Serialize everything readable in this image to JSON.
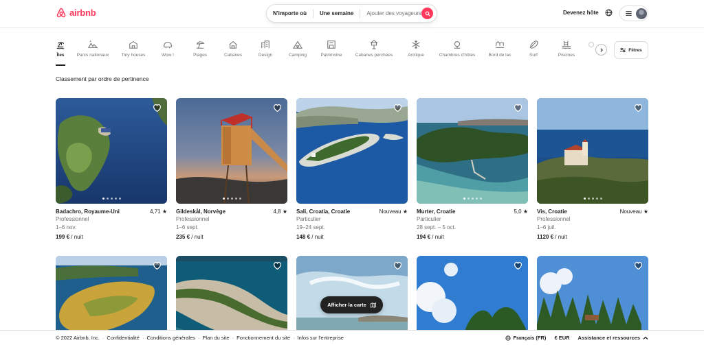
{
  "brand": {
    "name": "airbnb",
    "color": "#ff385c"
  },
  "search": {
    "where": "N'importe où",
    "when": "Une semaine",
    "who": "Ajouter des voyageurs",
    "button_icon": "search-icon"
  },
  "header": {
    "host_label": "Devenez hôte",
    "language_icon": "globe-icon",
    "menu_icon": "hamburger-icon"
  },
  "categories": [
    {
      "label": "Îles",
      "icon": "island-icon",
      "active": true
    },
    {
      "label": "Parcs nationaux",
      "icon": "national-park-icon"
    },
    {
      "label": "Tiny houses",
      "icon": "tiny-house-icon"
    },
    {
      "label": "Wow !",
      "icon": "wow-icon"
    },
    {
      "label": "Plages",
      "icon": "beach-icon"
    },
    {
      "label": "Cabanes",
      "icon": "cabin-icon"
    },
    {
      "label": "Design",
      "icon": "design-icon"
    },
    {
      "label": "Camping",
      "icon": "camping-icon"
    },
    {
      "label": "Patrimoine",
      "icon": "heritage-icon"
    },
    {
      "label": "Cabanes perchées",
      "icon": "treehouse-icon"
    },
    {
      "label": "Arctique",
      "icon": "snowflake-icon"
    },
    {
      "label": "Chambres d'hôtes",
      "icon": "bed-breakfast-icon"
    },
    {
      "label": "Bord de lac",
      "icon": "lake-icon"
    },
    {
      "label": "Surf",
      "icon": "surf-icon"
    },
    {
      "label": "Piscines",
      "icon": "pool-icon"
    }
  ],
  "filters_label": "Filtres",
  "sort_label": "Classement par ordre de pertinence",
  "listings": [
    {
      "title": "Badachro, Royaume-Uni",
      "rating": "4,71 ★",
      "host": "Professionnel",
      "dates": "1–6 nov.",
      "price": "199 €",
      "per": " / nuit"
    },
    {
      "title": "Gildeskål, Norvège",
      "rating": "4,8 ★",
      "host": "Professionnel",
      "dates": "1–6 sept.",
      "price": "235 €",
      "per": " / nuit"
    },
    {
      "title": "Sali, Croatia, Croatie",
      "rating": "Nouveau ★",
      "host": "Particulier",
      "dates": "19–24 sept.",
      "price": "148 €",
      "per": " / nuit"
    },
    {
      "title": "Murter, Croatie",
      "rating": "5,0 ★",
      "host": "Particulier",
      "dates": "28 sept. – 5 oct.",
      "price": "194 €",
      "per": " / nuit"
    },
    {
      "title": "Vis, Croatie",
      "rating": "Nouveau ★",
      "host": "Professionnel",
      "dates": "1–6 juil.",
      "price": "1120 €",
      "per": " / nuit"
    }
  ],
  "map_button": "Afficher la carte",
  "footer": {
    "copyright": "© 2022 Airbnb, Inc.",
    "links": [
      "Confidentialité",
      "Conditions générales",
      "Plan du site",
      "Fonctionnement du site",
      "Infos sur l'entreprise"
    ],
    "language": "Français (FR)",
    "currency": "€ EUR",
    "help": "Assistance et ressources"
  }
}
